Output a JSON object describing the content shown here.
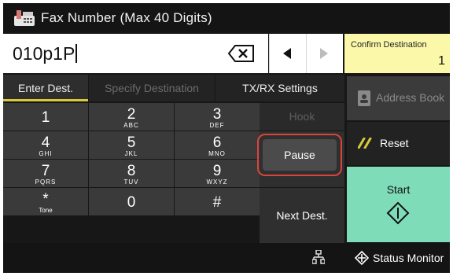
{
  "title": "Fax Number (Max 40 Digits)",
  "number_field": {
    "value": "010p1P"
  },
  "confirm_destination": {
    "label": "Confirm Destination",
    "count": "1"
  },
  "tabs": [
    {
      "label": "Enter Dest.",
      "state": "active"
    },
    {
      "label": "Specify Destination",
      "state": "disabled"
    },
    {
      "label": "TX/RX Settings",
      "state": "normal"
    }
  ],
  "keypad": [
    {
      "digit": "1",
      "letters": ""
    },
    {
      "digit": "2",
      "letters": "ABC"
    },
    {
      "digit": "3",
      "letters": "DEF"
    },
    {
      "digit": "4",
      "letters": "GHI"
    },
    {
      "digit": "5",
      "letters": "JKL"
    },
    {
      "digit": "6",
      "letters": "MNO"
    },
    {
      "digit": "7",
      "letters": "PQRS"
    },
    {
      "digit": "8",
      "letters": "TUV"
    },
    {
      "digit": "9",
      "letters": "WXYZ"
    },
    {
      "digit": "*",
      "letters": "Tone"
    },
    {
      "digit": "0",
      "letters": ""
    },
    {
      "digit": "#",
      "letters": ""
    }
  ],
  "side_buttons": {
    "hook": "Hook",
    "pause": "Pause",
    "next_dest": "Next Dest."
  },
  "right_buttons": {
    "address_book": "Address Book",
    "reset": "Reset",
    "start": "Start"
  },
  "status_monitor": "Status Monitor",
  "colors": {
    "accent_yellow": "#d9c93b",
    "start_green": "#7fdcb8",
    "confirm_bg": "#fbf9a9",
    "pause_ring": "#d9443c"
  }
}
